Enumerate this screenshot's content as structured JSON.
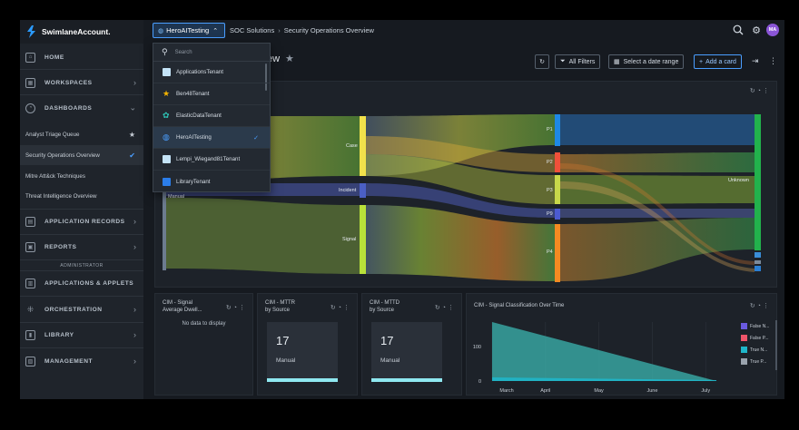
{
  "brand": {
    "name": "SwimlaneAccount."
  },
  "sidebar": {
    "home": "HOME",
    "workspaces": "WORKSPACES",
    "dashboards": "DASHBOARDS",
    "dashboard_items": [
      {
        "label": "Analyst Triage Queue",
        "mark": "★"
      },
      {
        "label": "Security Operations Overview",
        "mark": "✔"
      },
      {
        "label": "Mitre Att&ck Techniques",
        "mark": ""
      },
      {
        "label": "Threat Intelligence Overview",
        "mark": ""
      }
    ],
    "application_records": "APPLICATION RECORDS",
    "reports": "REPORTS",
    "administrator": "ADMINISTRATOR",
    "applications_applets": "APPLICATIONS & APPLETS",
    "orchestration": "ORCHESTRATION",
    "library": "LIBRARY",
    "management": "MANAGEMENT"
  },
  "header": {
    "tenant": "HeroAITesting",
    "breadcrumb": [
      "SOC Solutions",
      "Security Operations Overview"
    ],
    "avatar_initials": "MA"
  },
  "toolbar": {
    "title_partial": "ew",
    "all_filters": "All Filters",
    "date_range": "Select a date range",
    "add_card": "Add a card"
  },
  "tenant_dropdown": {
    "search_placeholder": "Search",
    "items": [
      {
        "label": "ApplicationsTenant",
        "color": "#c4e3f7",
        "icon": "square-icon"
      },
      {
        "label": "Ben48Tenant",
        "color": "#f5b400",
        "icon": "star-icon"
      },
      {
        "label": "ElasticDataTenant",
        "color": "#2ec4b6",
        "icon": "elastic-icon"
      },
      {
        "label": "HeroAITesting",
        "color": "#4a9eff",
        "icon": "globe-icon",
        "selected": true
      },
      {
        "label": "Lempi_Wiegand81Tenant",
        "color": "#c4e3f7",
        "icon": "square-icon"
      },
      {
        "label": "LibraryTenant",
        "color": "#2b7de9",
        "icon": "square-icon"
      }
    ]
  },
  "sankey": {
    "source_label": "Manual",
    "middle_labels": [
      "Case",
      "Incident",
      "Signal"
    ],
    "priority_labels": [
      "P1",
      "P2",
      "P3",
      "P9",
      "P4"
    ],
    "target_label": "Unknown"
  },
  "cards": {
    "dwell": {
      "title_line1": "CIM - Signal",
      "title_line2": "Average Dwell...",
      "no_data": "No data to display"
    },
    "mttr": {
      "title_line1": "CIM - MTTR",
      "title_line2": "by Source",
      "value": "17",
      "label": "Manual"
    },
    "mttd": {
      "title_line1": "CIM - MTTD",
      "title_line2": "by Source",
      "value": "17",
      "label": "Manual"
    },
    "classification": {
      "title": "CIM - Signal Classification Over Time"
    }
  },
  "chart_data": {
    "type": "area",
    "title": "CIM - Signal Classification Over Time",
    "x": [
      "March",
      "April",
      "May",
      "June",
      "July"
    ],
    "y_ticks": [
      0,
      100
    ],
    "series": [
      {
        "name": "False N...",
        "color": "#6a5adf"
      },
      {
        "name": "False P...",
        "color": "#f0556a"
      },
      {
        "name": "True N...",
        "color": "#1fb6c9"
      },
      {
        "name": "True P...",
        "color": "#9aa3ad"
      }
    ]
  }
}
